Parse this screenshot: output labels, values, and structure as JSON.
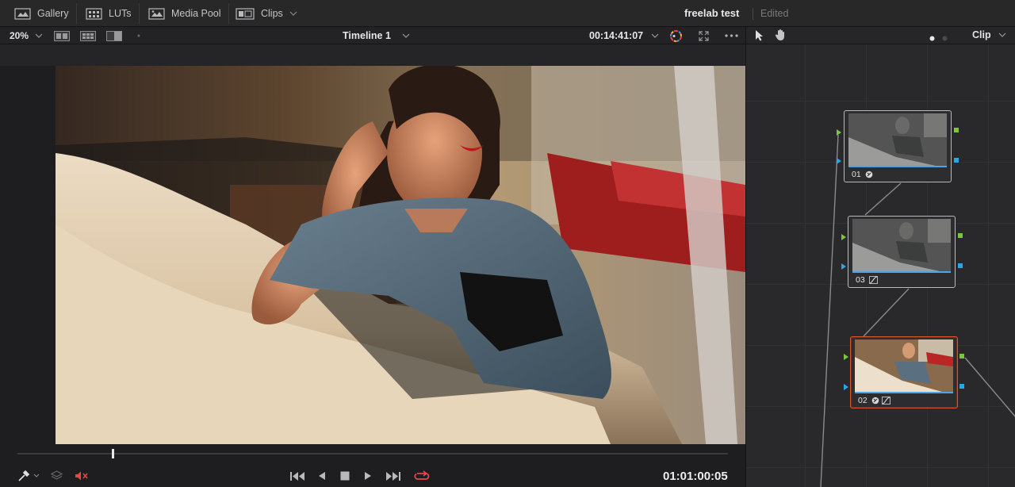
{
  "toolbar": {
    "gallery": "Gallery",
    "luts": "LUTs",
    "media_pool": "Media Pool",
    "clips": "Clips",
    "project_title": "freelab test",
    "project_status": "Edited"
  },
  "viewer": {
    "zoom": "20%",
    "timeline_name": "Timeline 1",
    "timecode": "00:14:41:07",
    "playhead_position": 0.135
  },
  "transport": {
    "timecode": "01:01:00:05"
  },
  "node_editor": {
    "mode_label": "Clip",
    "nodes": [
      {
        "number": "01",
        "icons": [
          "grade-icon"
        ],
        "active": false
      },
      {
        "number": "03",
        "icons": [
          "curves-icon"
        ],
        "active": false
      },
      {
        "number": "02",
        "icons": [
          "grade-icon",
          "curves-icon"
        ],
        "active": true
      }
    ]
  },
  "colors": {
    "accent_active": "#d9542b",
    "port_green": "#79c73a",
    "port_blue": "#29a6e8",
    "loop_red": "#e24848"
  }
}
